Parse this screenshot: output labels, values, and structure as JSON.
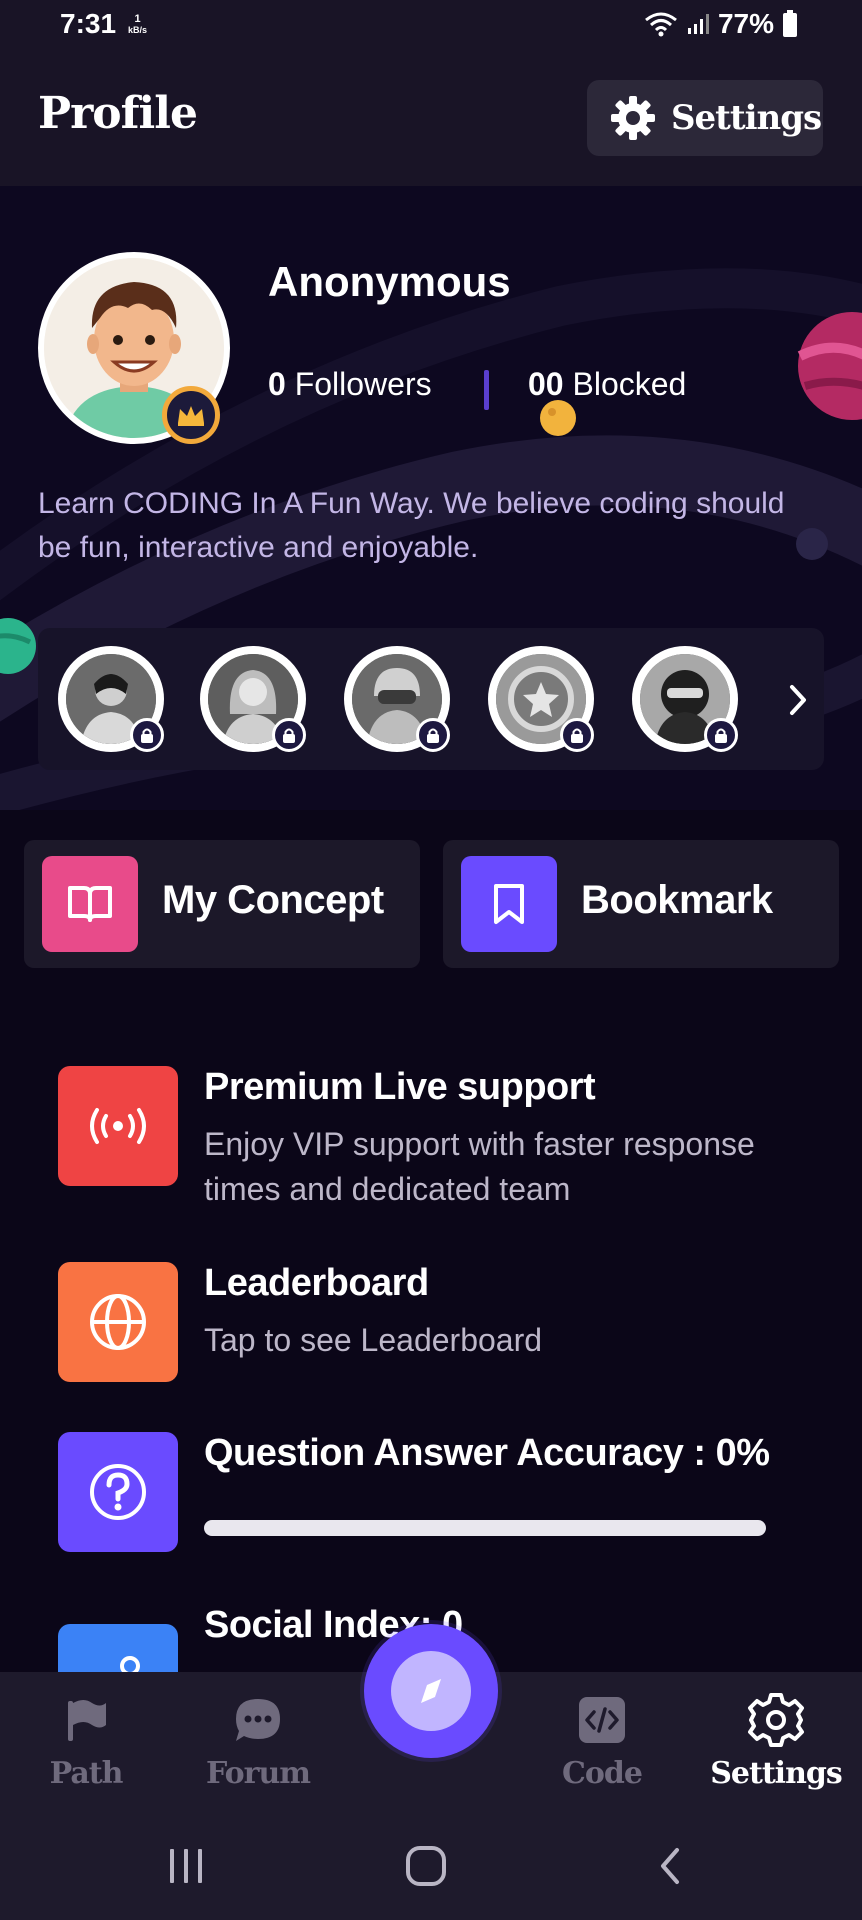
{
  "status_bar": {
    "time": "7:31",
    "net_speed_value": "1",
    "net_speed_unit": "kB/s",
    "battery": "77%",
    "icons": [
      "wifi-icon",
      "signal-icon",
      "battery-icon"
    ]
  },
  "header": {
    "title": "Profile",
    "settings_label": "Settings"
  },
  "profile": {
    "name": "Anonymous",
    "followers_count": "0",
    "followers_label": "Followers",
    "blocked_count": "00",
    "blocked_label": "Blocked",
    "bio": "Learn CODING In A Fun Way. We believe coding should be fun, interactive and enjoyable."
  },
  "badges": [
    {
      "name": "badge-1",
      "locked": true
    },
    {
      "name": "badge-2",
      "locked": true
    },
    {
      "name": "badge-3",
      "locked": true
    },
    {
      "name": "badge-4",
      "locked": true
    },
    {
      "name": "badge-5",
      "locked": true
    }
  ],
  "quick_actions": {
    "concept_label": "My Concept",
    "bookmark_label": "Bookmark"
  },
  "features": {
    "support": {
      "title": "Premium Live support",
      "desc": "Enjoy VIP support with faster response times and dedicated team"
    },
    "leaderboard": {
      "title": "Leaderboard",
      "desc": "Tap to see Leaderboard"
    },
    "accuracy": {
      "title": "Question Answer Accuracy : 0%",
      "progress": 0
    },
    "social": {
      "title": "Social Index: 0"
    }
  },
  "bottom_nav": {
    "path": "Path",
    "forum": "Forum",
    "code": "Code",
    "settings": "Settings",
    "active": "settings"
  },
  "colors": {
    "accent": "#6a4bff",
    "concept": "#e84b8a",
    "bookmark": "#6a4bff",
    "support": "#ef4444",
    "leaderboard": "#f97343",
    "accuracy": "#6a4bff",
    "social": "#3b82f6"
  }
}
